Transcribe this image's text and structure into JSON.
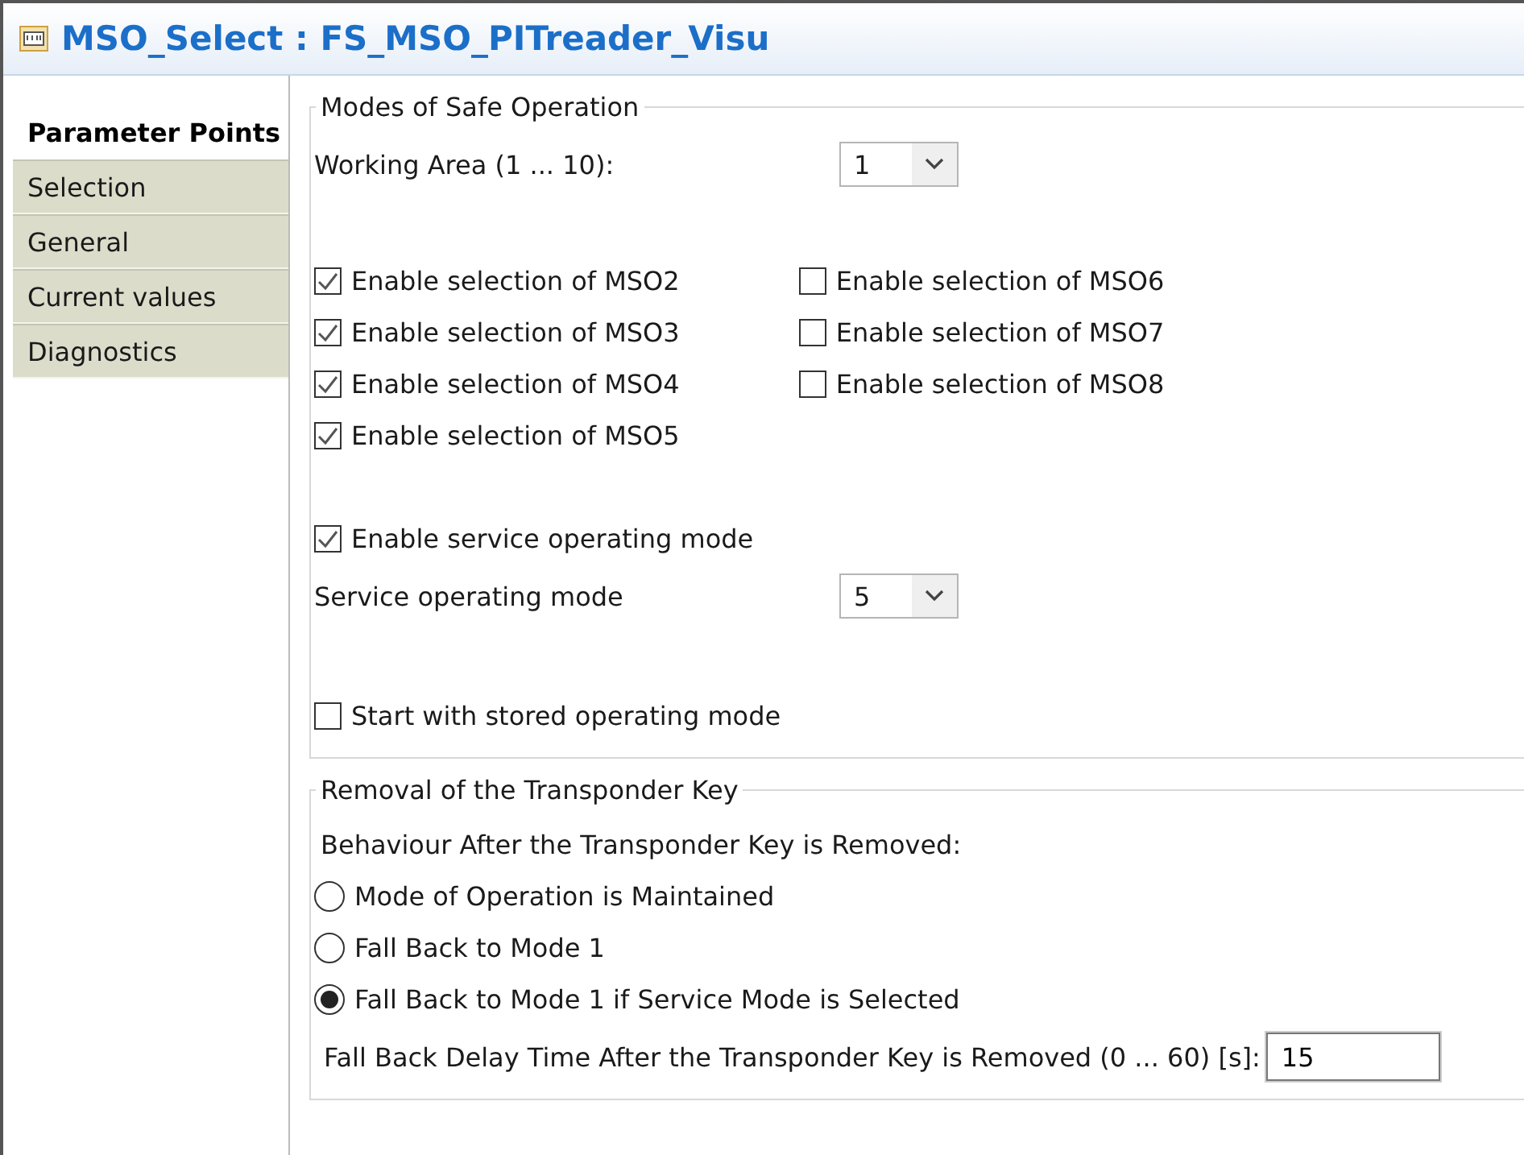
{
  "window": {
    "title": "MSO_Select : FS_MSO_PITreader_Visu"
  },
  "sidebar": {
    "items": [
      {
        "label": "Parameter Points",
        "selected": true
      },
      {
        "label": "Selection",
        "selected": false
      },
      {
        "label": "General",
        "selected": false
      },
      {
        "label": "Current values",
        "selected": false
      },
      {
        "label": "Diagnostics",
        "selected": false
      }
    ]
  },
  "modes_group": {
    "title": "Modes of Safe Operation",
    "working_area": {
      "label": "Working Area (1 ... 10):",
      "value": "1"
    },
    "mso_columns": [
      [
        {
          "label": "Enable selection of MSO2",
          "checked": true
        },
        {
          "label": "Enable selection of MSO3",
          "checked": true
        },
        {
          "label": "Enable selection of MSO4",
          "checked": true
        },
        {
          "label": "Enable selection of MSO5",
          "checked": true
        }
      ],
      [
        {
          "label": "Enable selection of MSO6",
          "checked": false
        },
        {
          "label": "Enable selection of MSO7",
          "checked": false
        },
        {
          "label": "Enable selection of MSO8",
          "checked": false
        }
      ]
    ],
    "service_enable": {
      "label": "Enable service operating mode",
      "checked": true
    },
    "service_mode": {
      "label": "Service operating mode",
      "value": "5"
    },
    "start_stored": {
      "label": "Start with stored operating mode",
      "checked": false
    }
  },
  "removal_group": {
    "title": "Removal of the Transponder Key",
    "behaviour_label": "Behaviour After the Transponder Key is Removed:",
    "options": [
      {
        "label": "Mode of Operation is Maintained",
        "selected": false
      },
      {
        "label": "Fall Back to Mode 1",
        "selected": false
      },
      {
        "label": "Fall Back to Mode 1 if Service Mode is Selected",
        "selected": true
      }
    ],
    "delay": {
      "label": "Fall Back Delay Time After the Transponder Key is Removed (0 ... 60) [s]:",
      "value": "15"
    }
  }
}
